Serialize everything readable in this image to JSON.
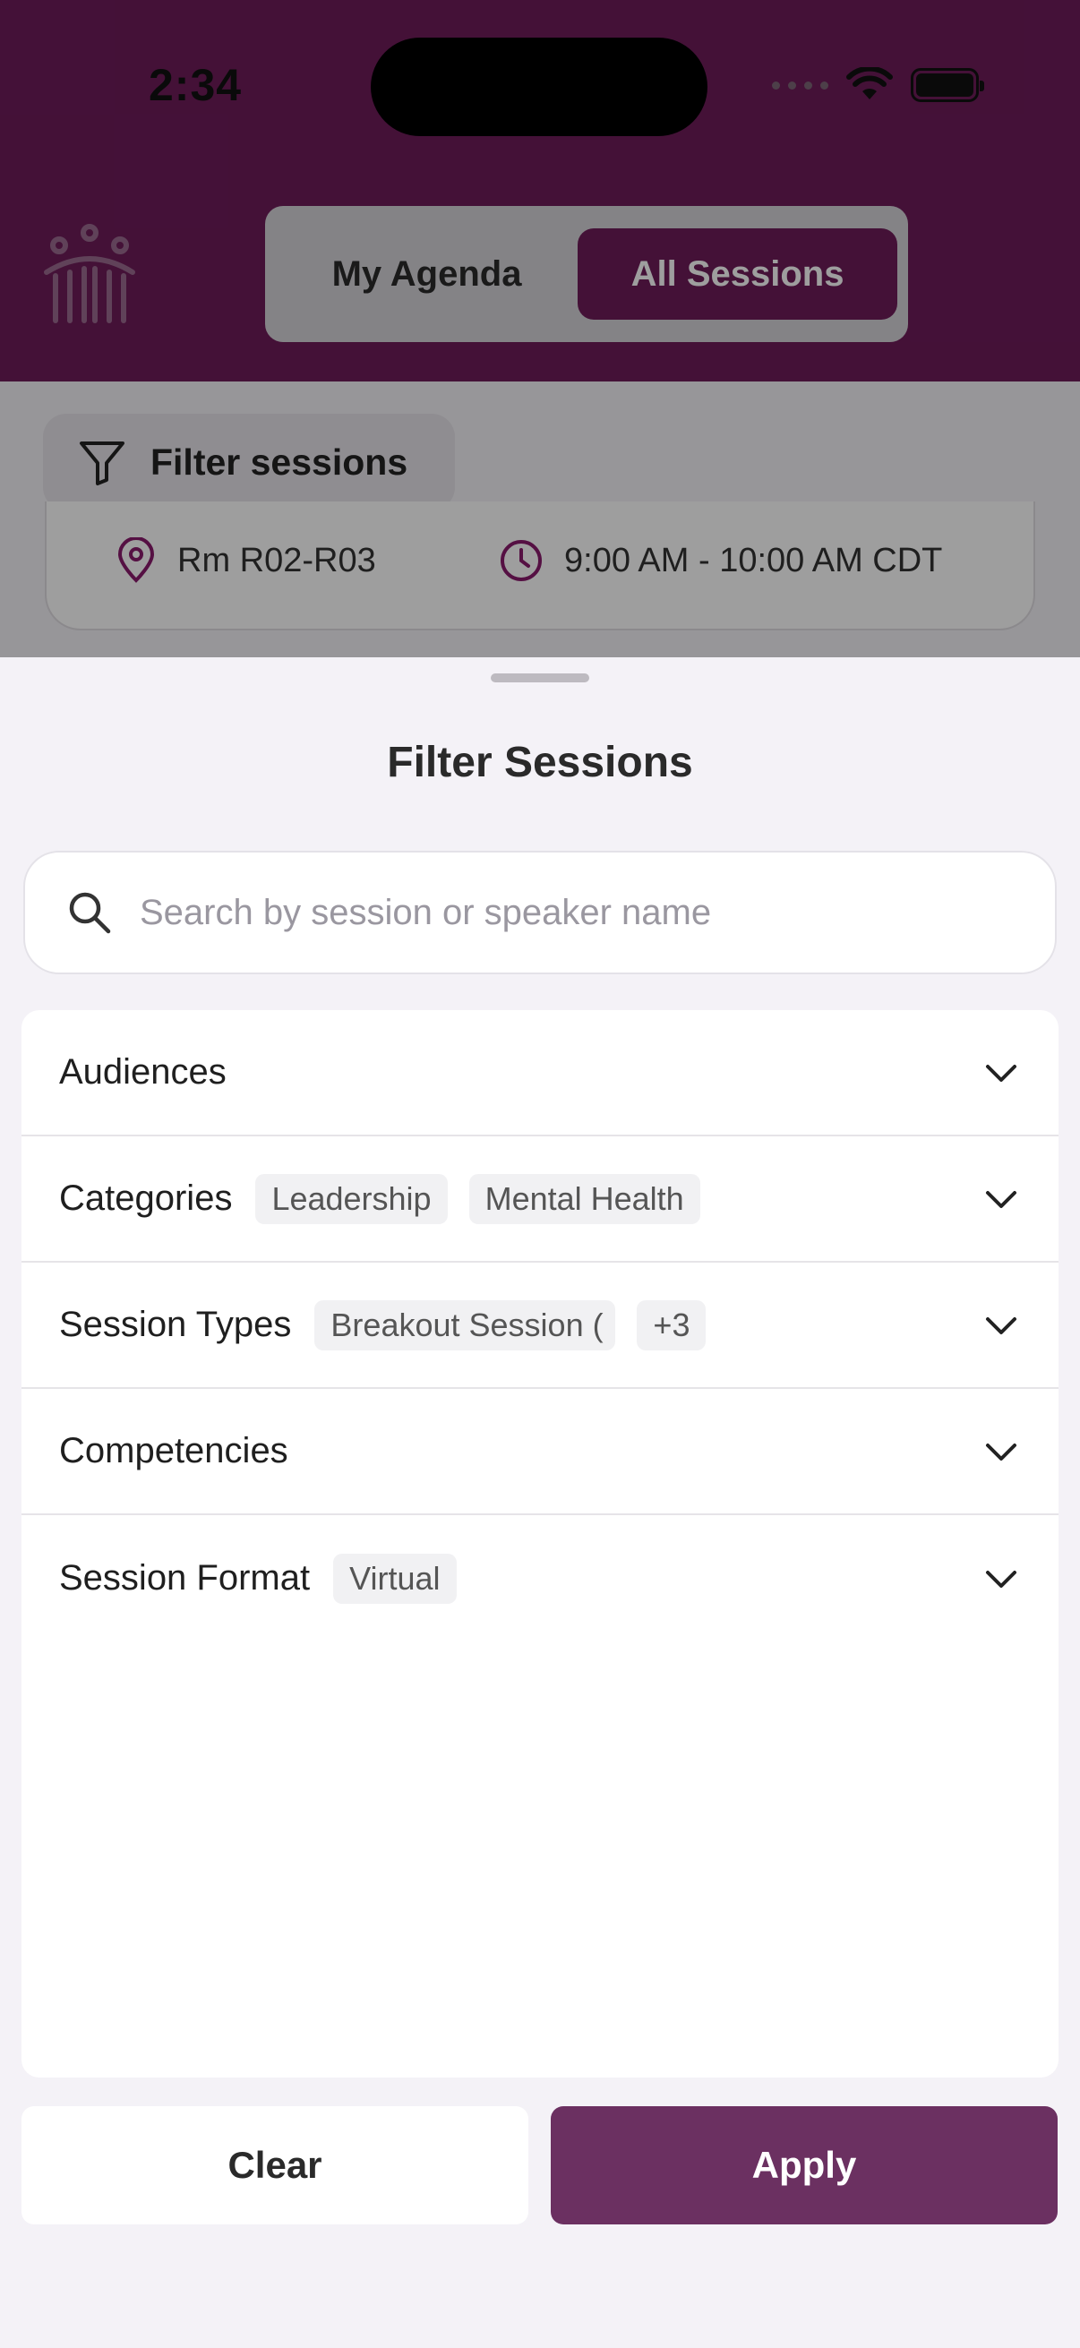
{
  "status_bar": {
    "time": "2:34"
  },
  "header": {
    "tabs": [
      {
        "label": "My Agenda",
        "selected": false
      },
      {
        "label": "All Sessions",
        "selected": true
      }
    ]
  },
  "filter_bar": {
    "button_label": "Filter sessions"
  },
  "session_card": {
    "room": "Rm R02-R03",
    "time": "9:00 AM - 10:00 AM CDT"
  },
  "sheet": {
    "title": "Filter Sessions",
    "search": {
      "placeholder": "Search by session or speaker name",
      "value": ""
    },
    "filters": [
      {
        "label": "Audiences",
        "tags": []
      },
      {
        "label": "Categories",
        "tags": [
          "Leadership",
          "Mental Health"
        ]
      },
      {
        "label": "Session Types",
        "tags": [
          "Breakout Session (",
          "+3"
        ]
      },
      {
        "label": "Competencies",
        "tags": []
      },
      {
        "label": "Session Format",
        "tags": [
          "Virtual"
        ]
      }
    ],
    "clear_label": "Clear",
    "apply_label": "Apply"
  },
  "colors": {
    "brand": "#6e1c5a",
    "apply": "#6b3061",
    "sheet_bg": "#f4f2f7"
  }
}
